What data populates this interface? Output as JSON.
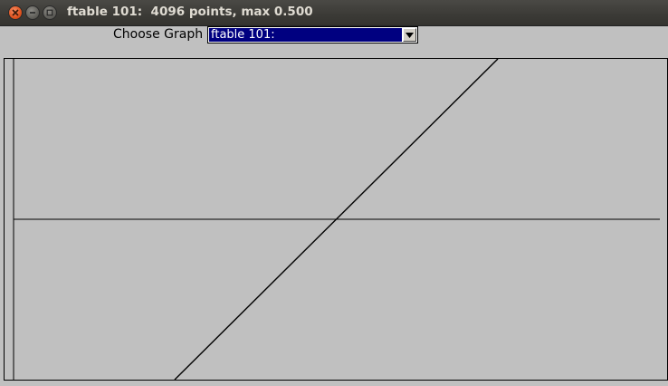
{
  "window": {
    "title": "ftable 101:  4096 points, max 0.500"
  },
  "toolbar": {
    "choose_label": "Choose Graph",
    "selected_graph": "ftable 101:"
  },
  "chart_data": {
    "type": "line",
    "series": [
      {
        "x": [
          0,
          1
        ],
        "y": [
          -1,
          1
        ]
      }
    ],
    "description_max": 0.5,
    "points": 4096,
    "grid": false,
    "colors": {
      "line": "#000000",
      "background": "#c0c0c0"
    }
  },
  "icons": {
    "close": "close-icon",
    "minimize": "minimize-icon",
    "maximize": "maximize-icon",
    "dropdown": "chevron-down-icon"
  }
}
